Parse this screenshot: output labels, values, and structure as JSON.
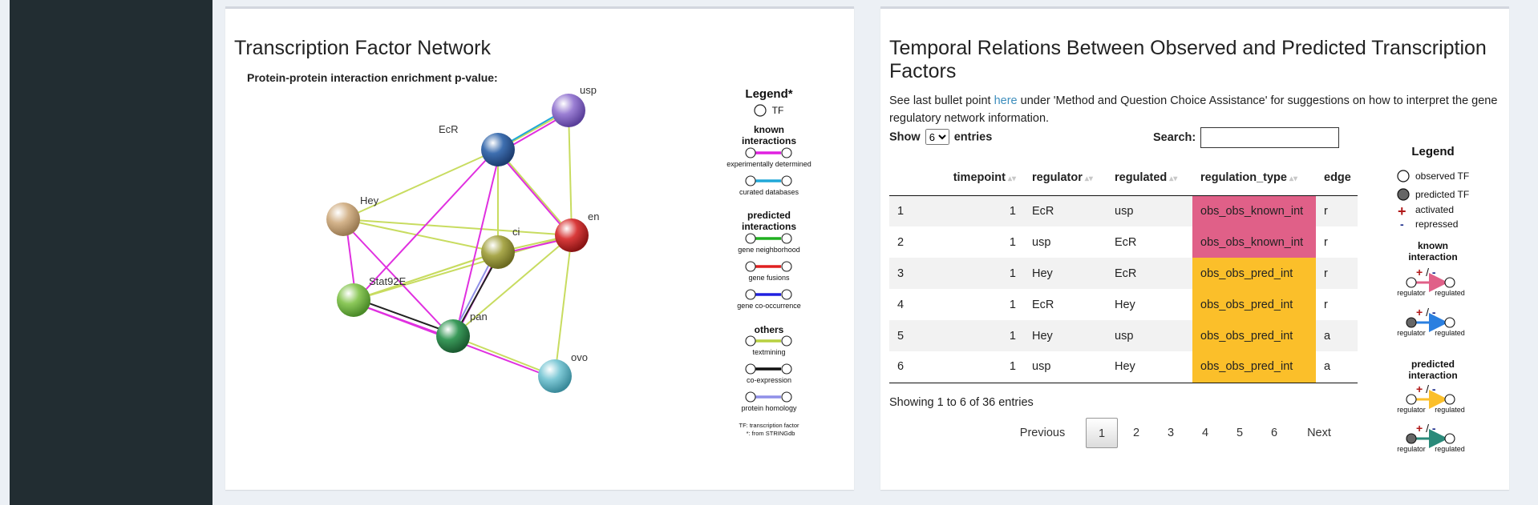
{
  "left_panel": {
    "title": "Transcription Factor Network",
    "pvalue_label": "Protein-protein interaction enrichment p-value:",
    "nodes": [
      {
        "label": "usp",
        "color": "#9b7fd4"
      },
      {
        "label": "EcR",
        "color": "#3e6fb0"
      },
      {
        "label": "Hey",
        "color": "#d4b48c"
      },
      {
        "label": "ci",
        "color": "#a9a84c"
      },
      {
        "label": "en",
        "color": "#d93b3b"
      },
      {
        "label": "Stat92E",
        "color": "#8cc85a"
      },
      {
        "label": "pan",
        "color": "#3a9a5a"
      },
      {
        "label": "ovo",
        "color": "#7fc9d6"
      }
    ],
    "legend": {
      "title": "Legend*",
      "tf_label": "TF",
      "known_title": "known interactions",
      "known_items": [
        {
          "label": "experimentally determined",
          "color": "#e020e0"
        },
        {
          "label": "curated databases",
          "color": "#20a8d8"
        }
      ],
      "predicted_title": "predicted interactions",
      "predicted_items": [
        {
          "label": "gene neighborhood",
          "color": "#20b020"
        },
        {
          "label": "gene fusions",
          "color": "#e02020"
        },
        {
          "label": "gene co-occurrence",
          "color": "#2020e0"
        }
      ],
      "others_title": "others",
      "others_items": [
        {
          "label": "textmining",
          "color": "#b8d040"
        },
        {
          "label": "co-expression",
          "color": "#111111"
        },
        {
          "label": "protein homology",
          "color": "#9090e8"
        }
      ],
      "footnote_1": "TF: transcription factor",
      "footnote_2": "*: from STRINGdb"
    }
  },
  "right_panel": {
    "title": "Temporal Relations Between Observed and Predicted Transcription Factors",
    "desc_before": "See last bullet point ",
    "desc_link": "here",
    "desc_after": " under 'Method and Question Choice Assistance' for suggestions on how to interpret the gene regulatory network information.",
    "show_label": "Show",
    "entries_label": "entries",
    "page_size": "6",
    "search_label": "Search:",
    "search_value": "",
    "columns": [
      "",
      "timepoint",
      "regulator",
      "regulated",
      "regulation_type",
      "edge"
    ],
    "rows": [
      {
        "idx": "1",
        "timepoint": "1",
        "regulator": "EcR",
        "regulated": "usp",
        "regulation_type": "obs_obs_known_int",
        "edge": "r"
      },
      {
        "idx": "2",
        "timepoint": "1",
        "regulator": "usp",
        "regulated": "EcR",
        "regulation_type": "obs_obs_known_int",
        "edge": "r"
      },
      {
        "idx": "3",
        "timepoint": "1",
        "regulator": "Hey",
        "regulated": "EcR",
        "regulation_type": "obs_obs_pred_int",
        "edge": "r"
      },
      {
        "idx": "4",
        "timepoint": "1",
        "regulator": "EcR",
        "regulated": "Hey",
        "regulation_type": "obs_obs_pred_int",
        "edge": "r"
      },
      {
        "idx": "5",
        "timepoint": "1",
        "regulator": "Hey",
        "regulated": "usp",
        "regulation_type": "obs_obs_pred_int",
        "edge": "a"
      },
      {
        "idx": "6",
        "timepoint": "1",
        "regulator": "usp",
        "regulated": "Hey",
        "regulation_type": "obs_obs_pred_int",
        "edge": "a"
      }
    ],
    "showing_text": "Showing 1 to 6 of 36 entries",
    "pagination": {
      "previous": "Previous",
      "pages": [
        "1",
        "2",
        "3",
        "4",
        "5",
        "6"
      ],
      "next": "Next",
      "current": "1"
    },
    "legend": {
      "title": "Legend",
      "observed_tf": "observed TF",
      "predicted_tf": "predicted TF",
      "activated": "activated",
      "repressed": "repressed",
      "known_title": "known interaction",
      "predicted_title": "predicted interaction",
      "plus_minus": "+ / -",
      "regulator": "regulator",
      "regulated": "regulated",
      "known_color": "#e06088",
      "known_pred_color": "#2a7fe0",
      "pred_color": "#fbbf2a",
      "pred_pred_color": "#2a8a7a"
    }
  }
}
